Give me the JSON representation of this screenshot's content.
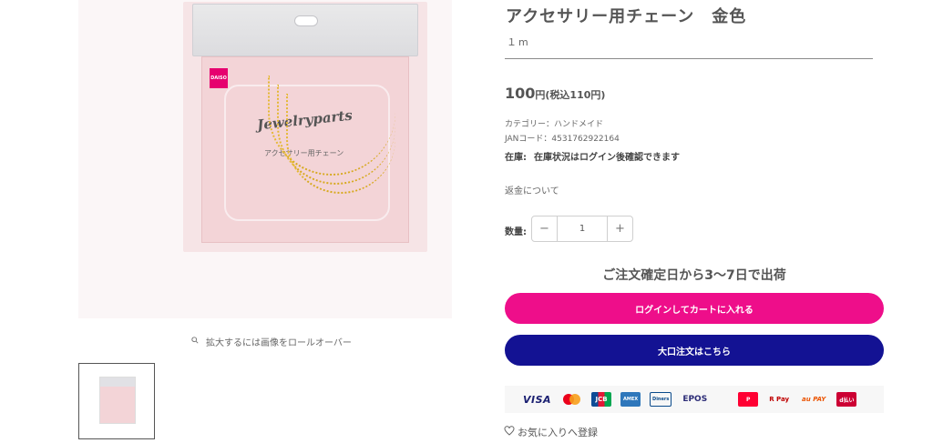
{
  "product": {
    "title": "アクセサリー用チェーン　金色",
    "unit": "１m",
    "price_amount": "100",
    "price_yen": "円",
    "price_tax": "(税込110円)",
    "category": "カテゴリー：ハンドメイド",
    "jan": "JANコード：4531762922164",
    "stock_label": "在庫:",
    "stock_value": "在庫状況はログイン後確認できます",
    "refund_link": "返金について",
    "quantity_label": "数量:",
    "quantity_value": "1",
    "shipping_note": "ご注文確定日から3〜7日で出荷",
    "cart_button": "ログインしてカートに入れる",
    "bulk_button": "大口注文はこちら",
    "favorite": "お気に入りへ登録"
  },
  "gallery": {
    "zoom_hint": "拡大するには画像をロールオーバー",
    "image_brand": "DAISO",
    "image_title": "Jewelryparts",
    "image_subtitle": "アクセサリー用チェーン",
    "image_size": "56"
  },
  "payments": [
    "VISA",
    "MasterCard",
    "JCB",
    "AMERICAN EXPRESS",
    "Diners Club",
    "EPOS",
    "PayPay",
    "R Pay",
    "au PAY",
    "d払い"
  ],
  "colors": {
    "cart_button": "#ee0e8a",
    "bulk_button": "#131293",
    "text": "#555555"
  }
}
